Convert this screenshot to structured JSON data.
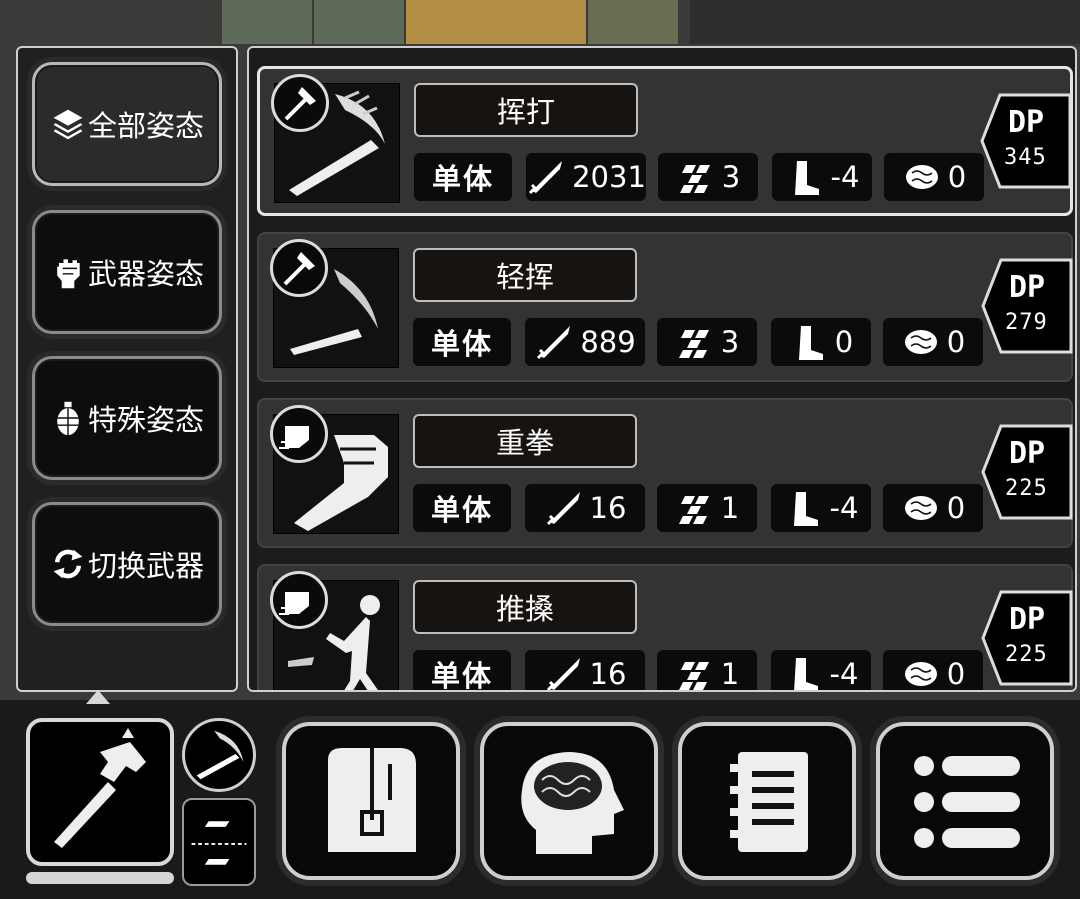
{
  "stances": [
    {
      "label": "全部姿态",
      "icon": "layers-icon",
      "active": true
    },
    {
      "label": "武器姿态",
      "icon": "fist-icon",
      "active": false
    },
    {
      "label": "特殊姿态",
      "icon": "grenade-icon",
      "active": false
    },
    {
      "label": "切换武器",
      "icon": "swap-arrows-icon",
      "active": false
    }
  ],
  "skills": [
    {
      "name": "挥打",
      "target": "单体",
      "damage": "2031",
      "accuracy": "3",
      "stamina": "-4",
      "mind": "0",
      "dp_label": "DP",
      "dp": "345",
      "weapon": "hammer-icon",
      "art": "bat-swing-icon",
      "selected": true
    },
    {
      "name": "轻挥",
      "target": "单体",
      "damage": "889",
      "accuracy": "3",
      "stamina": "0",
      "mind": "0",
      "dp_label": "DP",
      "dp": "279",
      "weapon": "hammer-icon",
      "art": "bat-light-swing-icon",
      "selected": false
    },
    {
      "name": "重拳",
      "target": "单体",
      "damage": "16",
      "accuracy": "1",
      "stamina": "-4",
      "mind": "0",
      "dp_label": "DP",
      "dp": "225",
      "weapon": "fist-icon",
      "art": "heavy-punch-icon",
      "selected": false
    },
    {
      "name": "推搡",
      "target": "单体",
      "damage": "16",
      "accuracy": "1",
      "stamina": "-4",
      "mind": "0",
      "dp_label": "DP",
      "dp": "225",
      "weapon": "fist-icon",
      "art": "shove-icon",
      "selected": false
    }
  ],
  "bottom_menu": [
    {
      "name": "inventory",
      "icon": "backpack-icon"
    },
    {
      "name": "mind",
      "icon": "brain-head-icon"
    },
    {
      "name": "notes",
      "icon": "notebook-icon"
    },
    {
      "name": "menu",
      "icon": "list-menu-icon"
    }
  ],
  "equipped_weapon": {
    "icon": "hammer-icon",
    "durability_fraction": 1.0
  },
  "colors": {
    "panel_border": "#cfcfcf",
    "card_bg": "#333333",
    "stat_bg": "#0b0b0b",
    "text": "#ffffff"
  }
}
